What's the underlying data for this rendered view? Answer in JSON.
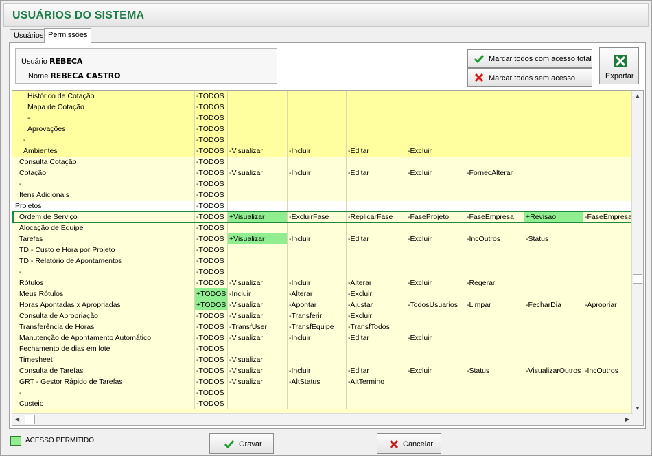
{
  "window": {
    "title": "USUÁRIOS DO SISTEMA"
  },
  "tabs": [
    {
      "label": "Usuários"
    },
    {
      "label": "Permissões"
    }
  ],
  "user": {
    "usuario_label": "Usuário",
    "usuario_value": "REBECA",
    "nome_label": "Nome",
    "nome_value": "REBECA CASTRO"
  },
  "actions": {
    "mark_all_full": "Marcar todos com acesso total",
    "mark_all_none": "Marcar todos sem acesso",
    "export": "Exportar"
  },
  "grid": {
    "rows": [
      {
        "name": "Histórico de Cotação",
        "indent": 3,
        "style": "hl",
        "cells": [
          "-TODOS",
          "",
          "",
          "",
          "",
          "",
          "",
          ""
        ]
      },
      {
        "name": "Mapa de Cotação",
        "indent": 3,
        "style": "hl",
        "cells": [
          "-TODOS",
          "",
          "",
          "",
          "",
          "",
          "",
          ""
        ]
      },
      {
        "name": "-",
        "indent": 3,
        "style": "hl",
        "cells": [
          "-TODOS",
          "",
          "",
          "",
          "",
          "",
          "",
          ""
        ]
      },
      {
        "name": "Aprovações",
        "indent": 3,
        "style": "hl",
        "cells": [
          "-TODOS",
          "",
          "",
          "",
          "",
          "",
          "",
          ""
        ]
      },
      {
        "name": "-",
        "indent": 2,
        "style": "hl",
        "cells": [
          "-TODOS",
          "",
          "",
          "",
          "",
          "",
          "",
          ""
        ]
      },
      {
        "name": "Ambientes",
        "indent": 2,
        "style": "hl",
        "cells": [
          "-TODOS",
          "-Visualizar",
          "-Incluir",
          "-Editar",
          "-Excluir",
          "",
          "",
          ""
        ]
      },
      {
        "name": "Consulta Cotação",
        "indent": 1,
        "style": "plain",
        "cells": [
          "-TODOS",
          "",
          "",
          "",
          "",
          "",
          "",
          ""
        ]
      },
      {
        "name": "Cotação",
        "indent": 1,
        "style": "plain",
        "cells": [
          "-TODOS",
          "-Visualizar",
          "-Incluir",
          "-Editar",
          "-Excluir",
          "-FornecAlterar",
          "",
          ""
        ]
      },
      {
        "name": "-",
        "indent": 1,
        "style": "plain",
        "cells": [
          "-TODOS",
          "",
          "",
          "",
          "",
          "",
          "",
          ""
        ]
      },
      {
        "name": "Itens Adicionais",
        "indent": 1,
        "style": "plain",
        "cells": [
          "-TODOS",
          "",
          "",
          "",
          "",
          "",
          "",
          ""
        ]
      },
      {
        "name": "Projetos",
        "indent": 0,
        "style": "white",
        "cells": [
          "-TODOS",
          "",
          "",
          "",
          "",
          "",
          "",
          ""
        ]
      },
      {
        "name": "Ordem de Serviço",
        "indent": 1,
        "style": "plain",
        "selected": true,
        "green": [
          1,
          6
        ],
        "cells": [
          "-TODOS",
          "+Visualizar",
          "-ExcluirFase",
          "-ReplicarFase",
          "-FaseProjeto",
          "-FaseEmpresa",
          "+Revisao",
          "-FaseEmpresa"
        ]
      },
      {
        "name": "Alocação de Equipe",
        "indent": 1,
        "style": "plain",
        "cells": [
          "-TODOS",
          "",
          "",
          "",
          "",
          "",
          "",
          ""
        ]
      },
      {
        "name": "Tarefas",
        "indent": 1,
        "style": "plain",
        "green": [
          1
        ],
        "cells": [
          "-TODOS",
          "+Visualizar",
          "-Incluir",
          "-Editar",
          "-Excluir",
          "-IncOutros",
          "-Status",
          ""
        ]
      },
      {
        "name": "TD - Custo e Hora por Projeto",
        "indent": 1,
        "style": "plain",
        "cells": [
          "-TODOS",
          "",
          "",
          "",
          "",
          "",
          "",
          ""
        ]
      },
      {
        "name": "TD - Relatório de Apontamentos",
        "indent": 1,
        "style": "plain",
        "cells": [
          "-TODOS",
          "",
          "",
          "",
          "",
          "",
          "",
          ""
        ]
      },
      {
        "name": "-",
        "indent": 1,
        "style": "plain",
        "cells": [
          "-TODOS",
          "",
          "",
          "",
          "",
          "",
          "",
          ""
        ]
      },
      {
        "name": "Rótulos",
        "indent": 1,
        "style": "plain",
        "cells": [
          "-TODOS",
          "-Visualizar",
          "-Incluir",
          "-Alterar",
          "-Excluir",
          "-Regerar",
          "",
          ""
        ]
      },
      {
        "name": "Meus Rótulos",
        "indent": 1,
        "style": "plain",
        "green": [
          0
        ],
        "cells": [
          "+TODOS",
          "-Incluir",
          "-Alterar",
          "-Excluir",
          "",
          "",
          "",
          ""
        ]
      },
      {
        "name": "Horas Apontadas x Apropriadas",
        "indent": 1,
        "style": "plain",
        "green": [
          0
        ],
        "cells": [
          "+TODOS",
          "-Visualizar",
          "-Apontar",
          "-Ajustar",
          "-TodosUsuarios",
          "-Limpar",
          "-FecharDia",
          "-Apropriar"
        ]
      },
      {
        "name": "Consulta de Apropriação",
        "indent": 1,
        "style": "plain",
        "cells": [
          "-TODOS",
          "-Visualizar",
          "-Transferir",
          "-Excluir",
          "",
          "",
          "",
          ""
        ]
      },
      {
        "name": "Transferência de Horas",
        "indent": 1,
        "style": "plain",
        "cells": [
          "-TODOS",
          "-TransfUser",
          "-TransfEquipe",
          "-TransfTodos",
          "",
          "",
          "",
          ""
        ]
      },
      {
        "name": "Manutenção de Apontamento Automático",
        "indent": 1,
        "style": "plain",
        "cells": [
          "-TODOS",
          "-Visualizar",
          "-Incluir",
          "-Editar",
          "-Excluir",
          "",
          "",
          ""
        ]
      },
      {
        "name": "Fechamento de dias em lote",
        "indent": 1,
        "style": "plain",
        "cells": [
          "-TODOS",
          "",
          "",
          "",
          "",
          "",
          "",
          ""
        ]
      },
      {
        "name": "Timesheet",
        "indent": 1,
        "style": "plain",
        "cells": [
          "-TODOS",
          "-Visualizar",
          "",
          "",
          "",
          "",
          "",
          ""
        ]
      },
      {
        "name": "Consulta de Tarefas",
        "indent": 1,
        "style": "plain",
        "cells": [
          "-TODOS",
          "-Visualizar",
          "-Incluir",
          "-Editar",
          "-Excluir",
          "-Status",
          "-VisualizarOutros",
          "-IncOutros"
        ]
      },
      {
        "name": "GRT - Gestor Rápido de Tarefas",
        "indent": 1,
        "style": "plain",
        "cells": [
          "-TODOS",
          "-Visualizar",
          "-AltStatus",
          "-AltTermino",
          "",
          "",
          "",
          ""
        ]
      },
      {
        "name": "-",
        "indent": 1,
        "style": "plain",
        "cells": [
          "-TODOS",
          "",
          "",
          "",
          "",
          "",
          "",
          ""
        ]
      },
      {
        "name": "Custeio",
        "indent": 1,
        "style": "plain",
        "cells": [
          "-TODOS",
          "",
          "",
          "",
          "",
          "",
          "",
          ""
        ]
      }
    ]
  },
  "legend": {
    "label": "ACESSO PERMITIDO",
    "color": "#90ee90"
  },
  "footer": {
    "save": "Gravar",
    "cancel": "Cancelar"
  },
  "icons": {
    "check": "green-check-icon",
    "x": "red-x-icon",
    "excel": "excel-icon"
  }
}
